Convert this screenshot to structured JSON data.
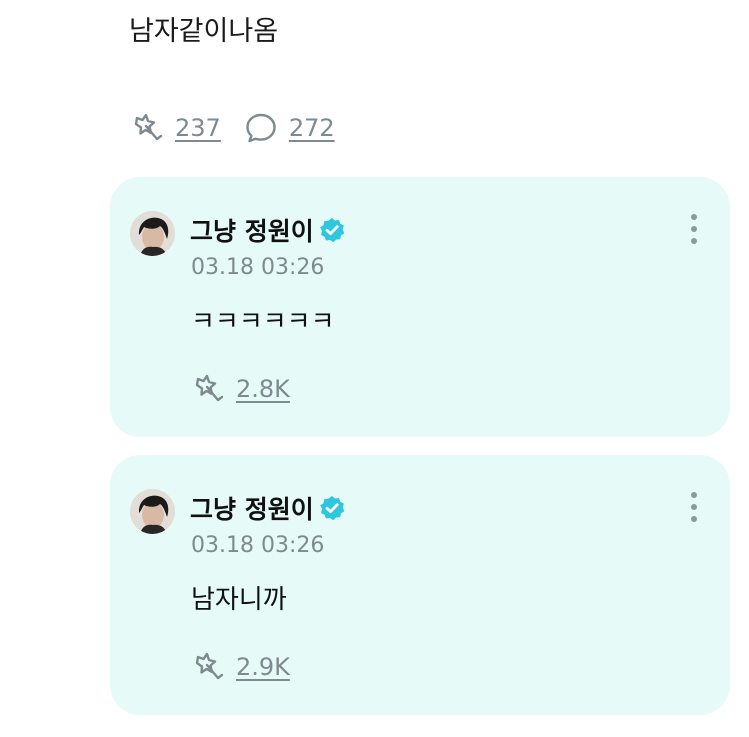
{
  "post": {
    "text": "남자같이나옴",
    "stats": {
      "likes_count": "237",
      "replies_count": "272",
      "like_icon": "like-star-icon",
      "reply_icon": "speech-bubble-icon"
    }
  },
  "comments": [
    {
      "author": "그냥 정원이",
      "verified": true,
      "timestamp": "03.18 03:26",
      "body": "ㅋㅋㅋㅋㅋㅋ",
      "likes_count": "2.8K"
    },
    {
      "author": "그냥 정원이",
      "verified": true,
      "timestamp": "03.18 03:26",
      "body": "남자니까",
      "likes_count": "2.9K"
    }
  ],
  "colors": {
    "comment_bg": "#e6fbf7",
    "verified": "#2ec7e0",
    "muted_text": "#7e8a8f"
  }
}
